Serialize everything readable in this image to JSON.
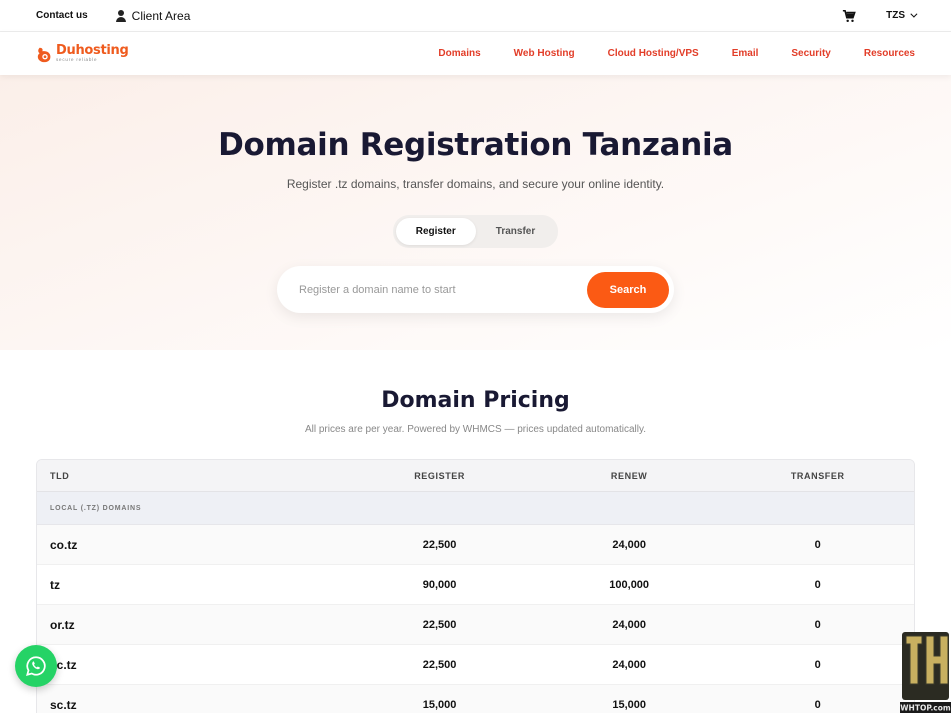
{
  "topbar": {
    "contact": "Contact us",
    "client_area": "Client Area",
    "currency": "TZS"
  },
  "logo": {
    "name": "Duhosting",
    "tagline": "secure reliable"
  },
  "nav": [
    "Domains",
    "Web Hosting",
    "Cloud Hosting/VPS",
    "Email",
    "Security",
    "Resources"
  ],
  "hero": {
    "title": "Domain Registration Tanzania",
    "subtitle": "Register .tz domains, transfer domains, and secure your online identity.",
    "tab_register": "Register",
    "tab_transfer": "Transfer",
    "search_placeholder": "Register a domain name to start",
    "search_button": "Search"
  },
  "pricing": {
    "title": "Domain Pricing",
    "note": "All prices are per year. Powered by WHMCS — prices updated automatically.",
    "columns": [
      "TLD",
      "REGISTER",
      "RENEW",
      "TRANSFER"
    ],
    "group": "LOCAL (.TZ) DOMAINS",
    "rows": [
      {
        "tld": "co.tz",
        "register": "22,500",
        "renew": "24,000",
        "transfer": "0"
      },
      {
        "tld": "tz",
        "register": "90,000",
        "renew": "100,000",
        "transfer": "0"
      },
      {
        "tld": "or.tz",
        "register": "22,500",
        "renew": "24,000",
        "transfer": "0"
      },
      {
        "tld": "ac.tz",
        "register": "22,500",
        "renew": "24,000",
        "transfer": "0"
      },
      {
        "tld": "sc.tz",
        "register": "15,000",
        "renew": "15,000",
        "transfer": "0"
      }
    ]
  },
  "icons": {
    "user": "user-icon",
    "cart": "cart-icon",
    "whatsapp": "whatsapp-icon",
    "brand_color": "#ef5b1e",
    "accent": "#fb5a14",
    "nav_color": "#e23d28"
  },
  "watermark": {
    "text": "WHTOP.com"
  }
}
